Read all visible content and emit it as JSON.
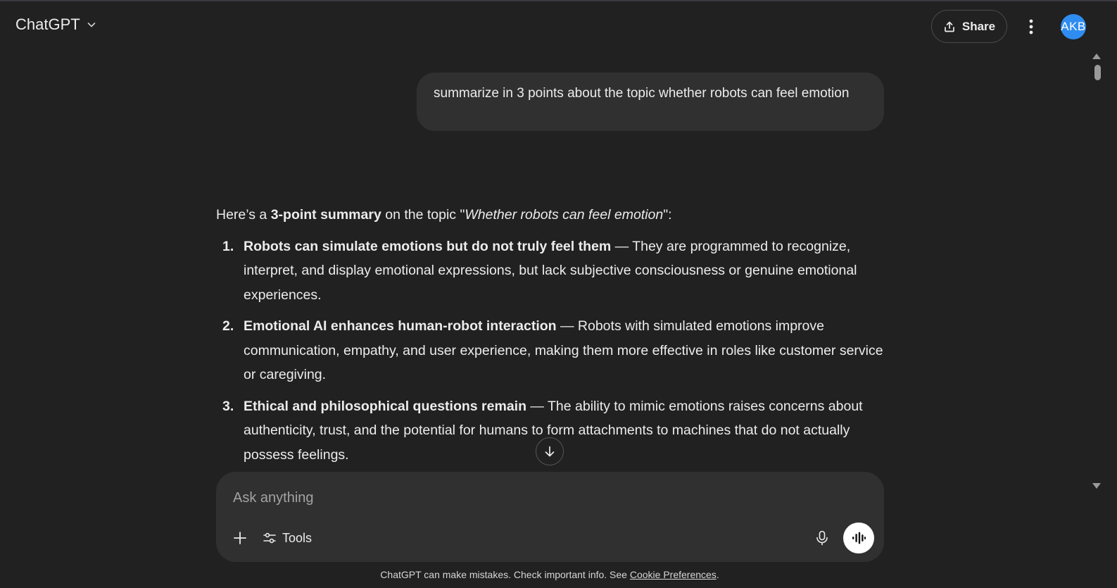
{
  "header": {
    "model_name": "ChatGPT",
    "share_label": "Share",
    "avatar_initials": "AKB",
    "avatar_color": "#2f8cf0"
  },
  "conversation": {
    "user_message": "summarize in 3 points about the topic whether robots can feel emotion",
    "assistant": {
      "intro_prefix": "Here’s a ",
      "intro_bold": "3-point summary",
      "intro_middle": " on the topic \"",
      "intro_italic": "Whether robots can feel emotion",
      "intro_suffix": "\":",
      "points": [
        {
          "number": "1.",
          "title": "Robots can simulate emotions but do not truly feel them",
          "text": " — They are programmed to recognize, interpret, and display emotional expressions, but lack subjective consciousness or genuine emotional experiences."
        },
        {
          "number": "2.",
          "title": "Emotional AI enhances human-robot interaction",
          "text": " — Robots with simulated emotions improve communication, empathy, and user experience, making them more effective in roles like customer service or caregiving."
        },
        {
          "number": "3.",
          "title": "Ethical and philosophical questions remain",
          "text": " — The ability to mimic emotions raises concerns about authenticity, trust, and the potential for humans to form attachments to machines that do not actually possess feelings."
        }
      ]
    }
  },
  "composer": {
    "placeholder": "Ask anything",
    "tools_label": "Tools"
  },
  "footer": {
    "note": "ChatGPT can make mistakes. Check important info. See ",
    "link": "Cookie Preferences",
    "end": "."
  },
  "icons": {
    "model_chevron": "chevron-down-icon",
    "share": "share-icon",
    "more": "more-vertical-icon",
    "scroll_down": "arrow-down-icon",
    "plus": "plus-icon",
    "tools": "sliders-icon",
    "mic": "microphone-icon",
    "voice": "voice-waveform-icon"
  }
}
